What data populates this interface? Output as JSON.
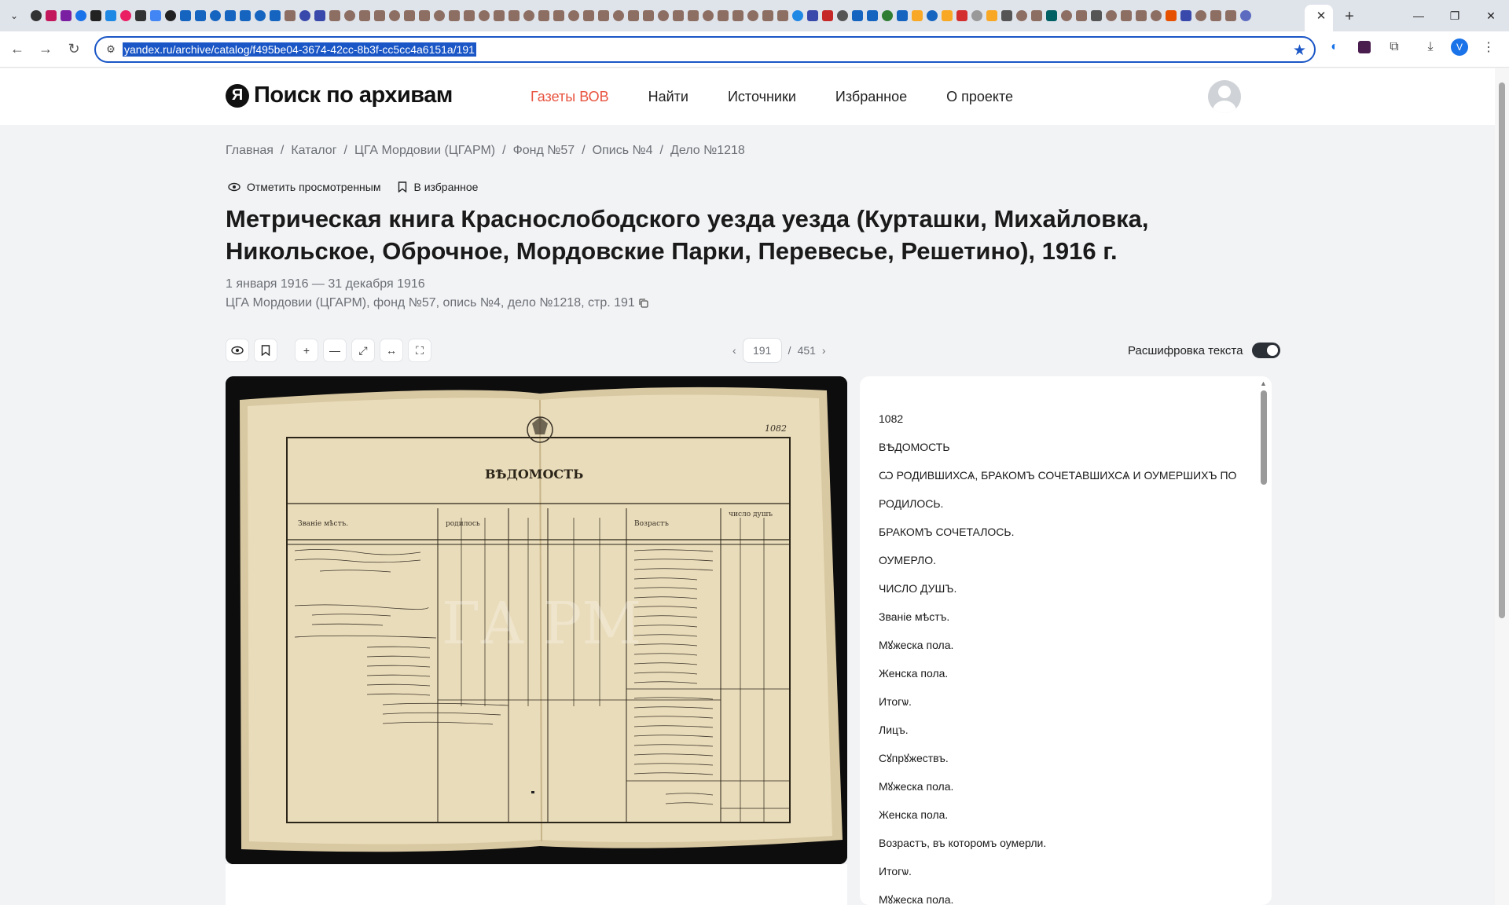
{
  "browser": {
    "url": "yandex.ru/archive/catalog/f495be04-3674-42cc-8b3f-cc5cc4a6151a/191",
    "favicon_colors": [
      "#333",
      "#c2185b",
      "#7b1fa2",
      "#1a73e8",
      "#222",
      "#1e88e5",
      "#e91e63",
      "#333",
      "#4285f4",
      "#222",
      "#1565c0",
      "#1565c0",
      "#1565c0",
      "#1565c0",
      "#1565c0",
      "#1565c0",
      "#1565c0",
      "#8d6e63",
      "#3949ab",
      "#3949ab",
      "#8d6e63",
      "#8d6e63",
      "#8d6e63",
      "#8d6e63",
      "#8d6e63",
      "#8d6e63",
      "#8d6e63",
      "#8d6e63",
      "#8d6e63",
      "#8d6e63",
      "#8d6e63",
      "#8d6e63",
      "#8d6e63",
      "#8d6e63",
      "#8d6e63",
      "#8d6e63",
      "#8d6e63",
      "#8d6e63",
      "#8d6e63",
      "#8d6e63",
      "#8d6e63",
      "#8d6e63",
      "#8d6e63",
      "#8d6e63",
      "#8d6e63",
      "#8d6e63",
      "#8d6e63",
      "#8d6e63",
      "#8d6e63",
      "#8d6e63",
      "#8d6e63",
      "#1e88e5",
      "#3949ab",
      "#c62828",
      "#555",
      "#1565c0",
      "#1565c0",
      "#2e7d32",
      "#1565c0",
      "#f9a825",
      "#1565c0",
      "#f9a825",
      "#d32f2f",
      "#999",
      "#f9a825",
      "#555",
      "#8d6e63",
      "#8d6e63",
      "#006064",
      "#8d6e63",
      "#8d6e63",
      "#555",
      "#8d6e63",
      "#8d6e63",
      "#8d6e63",
      "#8d6e63",
      "#e65100",
      "#3949ab",
      "#8d6e63",
      "#8d6e63",
      "#8d6e63",
      "#5c6bc0"
    ],
    "window_buttons": [
      "—",
      "❐",
      "✕"
    ]
  },
  "header": {
    "logo_letter": "Я",
    "logo_text": "Поиск по архивам",
    "nav": [
      "Газеты ВОВ",
      "Найти",
      "Источники",
      "Избранное",
      "О проекте"
    ]
  },
  "breadcrumbs": [
    "Главная",
    "Каталог",
    "ЦГА Мордовии (ЦГАРМ)",
    "Фонд №57",
    "Опись №4",
    "Дело №1218"
  ],
  "actions": {
    "mark_viewed": "Отметить просмотренным",
    "favorite": "В избранное"
  },
  "document": {
    "title": "Метрическая книга Краснослободского уезда уезда (Курташки, Михайловка, Никольское, Оброчное, Мордовские Парки, Перевесье, Решетино), 1916 г.",
    "dates": "1 января 1916 — 31 декабря 1916",
    "source": "ЦГА Мордовии (ЦГАРМ), фонд №57, опись №4, дело №1218, стр. 191"
  },
  "pager": {
    "current": "191",
    "separator": "/",
    "total": "451"
  },
  "decode_label": "Расшифровка текста",
  "transcription": [
    "1082",
    "ВѢДОМОСТЬ",
    "Ѡ РОДИВШИХСѦ, БРАКОМЪ СОЧЕТАВШИХСѦ И ОУМЕРШИХЪ ПО",
    "РОДИЛОСЬ.",
    "БРАКОМЪ СОЧЕТАЛОСЬ.",
    "ОУМЕРЛО.",
    "ЧИСЛО ДУШЪ.",
    "Званіе мѣстъ.",
    "Мꙋжеска пола.",
    "Женска пола.",
    "Итогѡ.",
    "Лицъ.",
    "Сꙋпрꙋжествъ.",
    "Мꙋжеска пола.",
    "Женска пола.",
    "Возрастъ, въ которомъ оумерли.",
    "Итогѡ.",
    "Мꙋжеска пола."
  ],
  "scan": {
    "sheet_title": "ВѢДОМОСТЬ",
    "page_number": "1082",
    "watermark": "ГА РМ"
  }
}
